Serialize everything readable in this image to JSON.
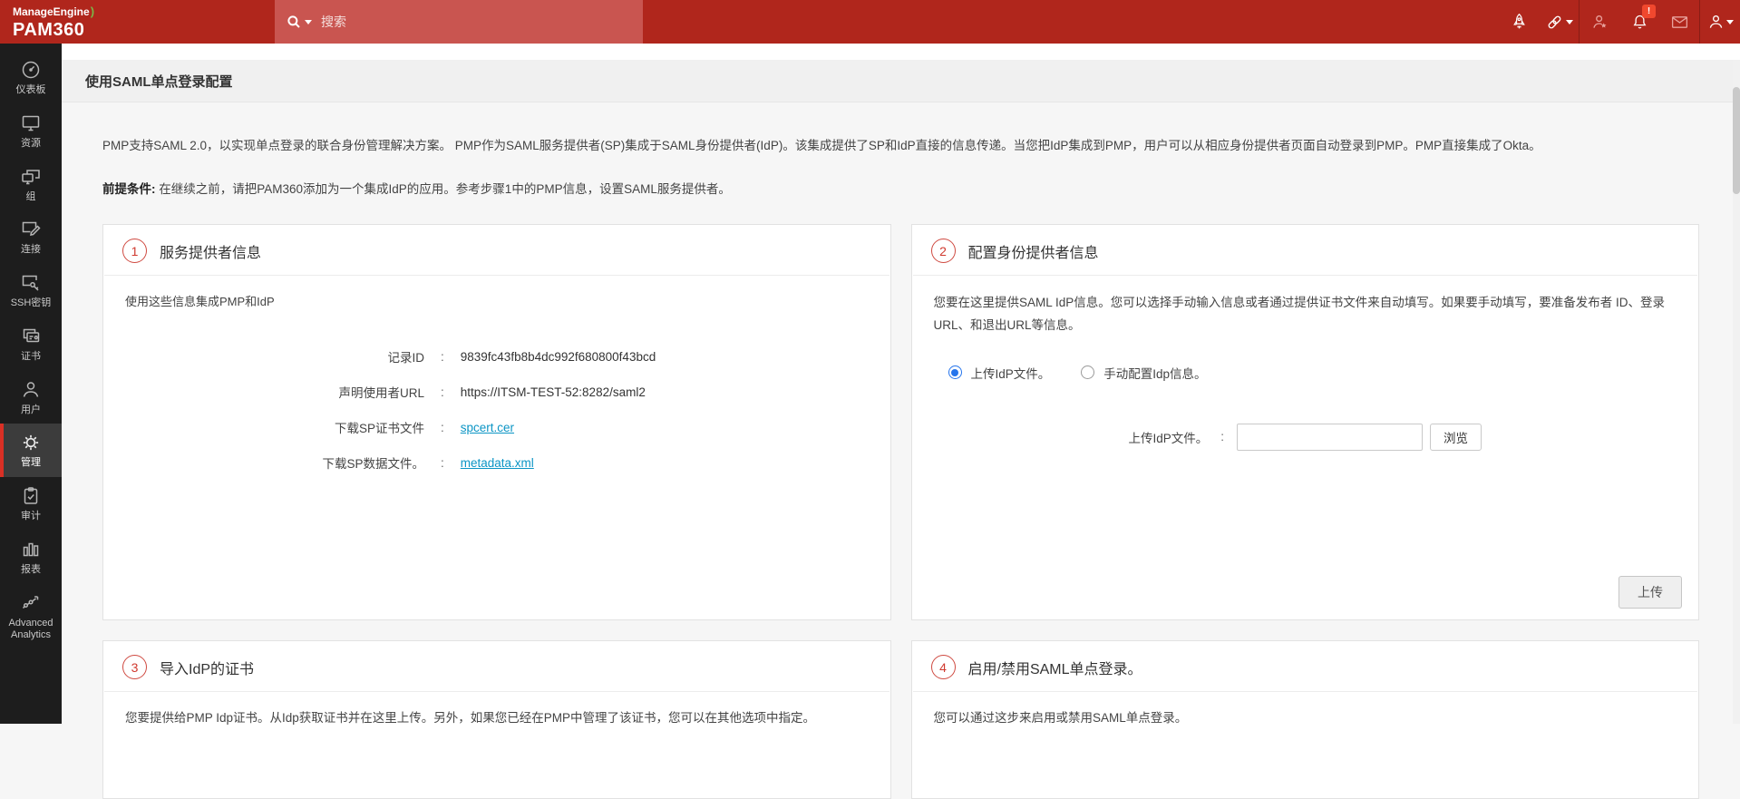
{
  "ui": {
    "colon": ":"
  },
  "header": {
    "brand": "ManageEngine",
    "swoosh": ")",
    "product": "PAM360",
    "search_placeholder": "搜索",
    "notification_badge": "!"
  },
  "sidebar": {
    "items": [
      {
        "label": "仪表板",
        "icon": "gauge-icon",
        "active": false
      },
      {
        "label": "资源",
        "icon": "monitor-icon",
        "active": false
      },
      {
        "label": "组",
        "icon": "monitor-group-icon",
        "active": false
      },
      {
        "label": "连接",
        "icon": "monitor-edit-icon",
        "active": false
      },
      {
        "label": "SSH密钥",
        "icon": "monitor-key-icon",
        "active": false
      },
      {
        "label": "证书",
        "icon": "certificate-icon",
        "active": false
      },
      {
        "label": "用户",
        "icon": "user-icon",
        "active": false
      },
      {
        "label": "管理",
        "icon": "gear-icon",
        "active": true
      },
      {
        "label": "审计",
        "icon": "clipboard-check-icon",
        "active": false
      },
      {
        "label": "报表",
        "icon": "bar-chart-icon",
        "active": false
      },
      {
        "label": "Advanced Analytics",
        "icon": "analytics-icon",
        "active": false
      }
    ]
  },
  "page": {
    "title": "使用SAML单点登录配置",
    "intro": "PMP支持SAML 2.0，以实现单点登录的联合身份管理解决方案。 PMP作为SAML服务提供者(SP)集成于SAML身份提供者(IdP)。该集成提供了SP和IdP直接的信息传递。当您把IdP集成到PMP，用户可以从相应身份提供者页面自动登录到PMP。PMP直接集成了Okta。",
    "prereq_label": "前提条件:",
    "prereq_text": "在继续之前，请把PAM360添加为一个集成IdP的应用。参考步骤1中的PMP信息，设置SAML服务提供者。"
  },
  "sections": {
    "s1": {
      "number": "1",
      "title": "服务提供者信息",
      "subtitle": "使用这些信息集成PMP和IdP",
      "rows": [
        {
          "label": "记录ID",
          "value": "9839fc43fb8b4dc992f680800f43bcd"
        },
        {
          "label": "声明使用者URL",
          "value": "https://ITSM-TEST-52:8282/saml2"
        },
        {
          "label": "下载SP证书文件",
          "value": "spcert.cer"
        },
        {
          "label": "下载SP数据文件。",
          "value": "metadata.xml"
        }
      ]
    },
    "s2": {
      "number": "2",
      "title": "配置身份提供者信息",
      "description": "您要在这里提供SAML IdP信息。您可以选择手动输入信息或者通过提供证书文件来自动填写。如果要手动填写，要准备发布者 ID、登录URL、和退出URL等信息。",
      "radio_upload_label": "上传IdP文件。",
      "radio_manual_label": "手动配置Idp信息。",
      "upload_field_label": "上传IdP文件。",
      "browse_button": "浏览",
      "upload_button": "上传"
    },
    "s3": {
      "number": "3",
      "title": "导入IdP的证书",
      "description": "您要提供给PMP Idp证书。从Idp获取证书并在这里上传。另外，如果您已经在PMP中管理了该证书，您可以在其他选项中指定。"
    },
    "s4": {
      "number": "4",
      "title": "启用/禁用SAML单点登录。",
      "description": "您可以通过这步来启用或禁用SAML单点登录。"
    }
  }
}
